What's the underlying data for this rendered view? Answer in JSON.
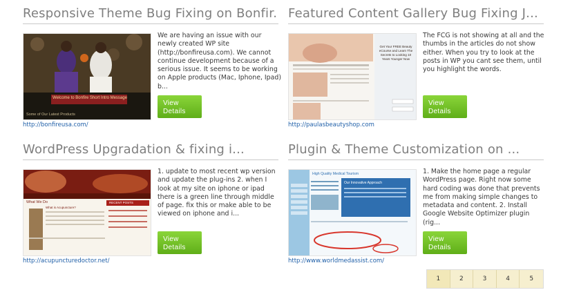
{
  "projects": [
    {
      "title": "Responsive Theme Bug Fixing on Bonfir...",
      "description": "We are having an issue with our newly created WP site (http://bonfireusa.com). We cannot continue development because of a serious issue. It seems to be working on Apple products (Mac, Iphone, Ipad) b...",
      "button": "View Details",
      "link": "http://bonfireusa.com/",
      "thumb_texts": [
        "Welcome to Bonfire Short Intro Message",
        "Some of Our Latest Products"
      ]
    },
    {
      "title": "Featured Content Gallery Bug Fixing J...",
      "description": "The FCG is not showing at all and the thumbs in the articles do not show either. When you try to look at the posts in WP you cant see them, until you highlight the words.",
      "button": "View Details",
      "link": "http://paulasbeautyshop.com",
      "thumb_texts": [
        "Get Your FREE Beauty eCourse and Learn The Secrets to Looking 10 Years Younger Now"
      ]
    },
    {
      "title": "WordPress Upgradation & fixing i...",
      "description": "1. update to most recent wp version and update the plug-ins 2. when I look at my site on iphone or ipad there is a green line through middle of page. fix this or make able to be viewed on iphone and i...",
      "button": "View Details",
      "link": "http://acupuncturedoctor.net/",
      "thumb_texts": [
        "What We Do",
        "What is Acupuncture?",
        "RECENT POSTS"
      ]
    },
    {
      "title": "Plugin & Theme Customization on ...",
      "description": "1. Make the home page a regular WordPress page. Right now some hard coding was done that prevents me from making simple changes to metadata and content. 2. Install Google Website Optimizer plugin (rig...",
      "button": "View Details",
      "link": "http://www.worldmedassist.com/",
      "thumb_texts": [
        "High Quality Medical Tourism",
        "Our Innovative Approach"
      ]
    }
  ],
  "pagination": [
    "1",
    "2",
    "3",
    "4",
    "5"
  ],
  "colors": {
    "button": "#6dbf22",
    "link": "#1f5fa8",
    "title": "#7f7f7f"
  }
}
